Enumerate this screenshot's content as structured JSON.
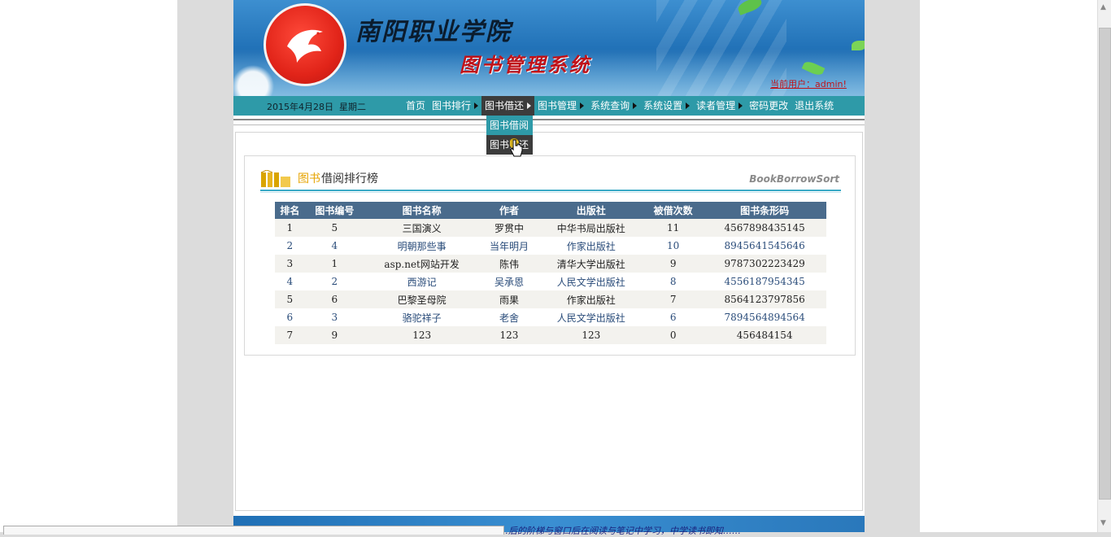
{
  "header": {
    "school_name": "南阳职业学院",
    "system_name": "图书管理系统",
    "current_user": "当前用户：admin!"
  },
  "nav": {
    "date": "2015年4月28日",
    "weekday": "星期二",
    "items": [
      {
        "label": "首页",
        "has_submenu": false
      },
      {
        "label": "图书排行",
        "has_submenu": true
      },
      {
        "label": "图书借还",
        "has_submenu": true,
        "active": true
      },
      {
        "label": "图书管理",
        "has_submenu": true
      },
      {
        "label": "系统查询",
        "has_submenu": true
      },
      {
        "label": "系统设置",
        "has_submenu": true
      },
      {
        "label": "读者管理",
        "has_submenu": true
      },
      {
        "label": "密码更改",
        "has_submenu": false
      },
      {
        "label": "退出系统",
        "has_submenu": false
      }
    ]
  },
  "dropdown": {
    "items": [
      {
        "label": "图书借阅"
      },
      {
        "label": "图书归还"
      }
    ]
  },
  "panel": {
    "title_a": "图书",
    "title_b": "借阅排行榜",
    "subtitle": "BookBorrowSort"
  },
  "table": {
    "headers": [
      "排名",
      "图书编号",
      "图书名称",
      "作者",
      "出版社",
      "被借次数",
      "图书条形码"
    ],
    "rows": [
      [
        "1",
        "5",
        "三国演义",
        "罗贯中",
        "中华书局出版社",
        "11",
        "4567898435145"
      ],
      [
        "2",
        "4",
        "明朝那些事",
        "当年明月",
        "作家出版社",
        "10",
        "8945641545646"
      ],
      [
        "3",
        "1",
        "asp.net网站开发",
        "陈伟",
        "清华大学出版社",
        "9",
        "9787302223429"
      ],
      [
        "4",
        "2",
        "西游记",
        "吴承恩",
        "人民文学出版社",
        "8",
        "4556187954345"
      ],
      [
        "5",
        "6",
        "巴黎圣母院",
        "雨果",
        "作家出版社",
        "7",
        "8564123797856"
      ],
      [
        "6",
        "3",
        "骆驼祥子",
        "老舍",
        "人民文学出版社",
        "6",
        "7894564894564"
      ],
      [
        "7",
        "9",
        "123",
        "123",
        "123",
        "0",
        "456484154"
      ]
    ]
  },
  "footer": {
    "text": "……后的阶梯与窗口后在阅读与笔记中学习，中学读书即知……"
  },
  "colors": {
    "nav_bg": "#2e9aa8",
    "nav_active_bg": "#3c3c3c",
    "table_header_bg": "#4a6b8c",
    "accent_red": "#c0131a"
  }
}
